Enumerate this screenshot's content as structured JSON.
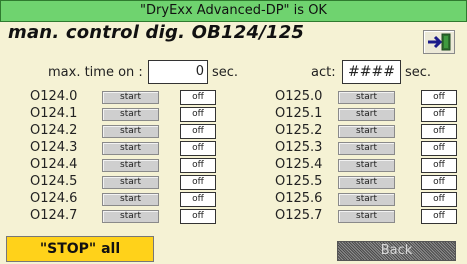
{
  "status_bar": "\"DryExx Advanced-DP\" is OK",
  "title": "man. control dig.  OB124/125",
  "max_time": {
    "label": "max. time on :",
    "value": "0",
    "unit": "sec."
  },
  "act": {
    "label": "act:",
    "value": "####",
    "unit": "sec."
  },
  "left_column": [
    {
      "label": "O124.0",
      "start": "start",
      "state": "off"
    },
    {
      "label": "O124.1",
      "start": "start",
      "state": "off"
    },
    {
      "label": "O124.2",
      "start": "start",
      "state": "off"
    },
    {
      "label": "O124.3",
      "start": "start",
      "state": "off"
    },
    {
      "label": "O124.4",
      "start": "start",
      "state": "off"
    },
    {
      "label": "O124.5",
      "start": "start",
      "state": "off"
    },
    {
      "label": "O124.6",
      "start": "start",
      "state": "off"
    },
    {
      "label": "O124.7",
      "start": "start",
      "state": "off"
    }
  ],
  "right_column": [
    {
      "label": "O125.0",
      "start": "start",
      "state": "off"
    },
    {
      "label": "O125.1",
      "start": "start",
      "state": "off"
    },
    {
      "label": "O125.2",
      "start": "start",
      "state": "off"
    },
    {
      "label": "O125.3",
      "start": "start",
      "state": "off"
    },
    {
      "label": "O125.4",
      "start": "start",
      "state": "off"
    },
    {
      "label": "O125.5",
      "start": "start",
      "state": "off"
    },
    {
      "label": "O125.6",
      "start": "start",
      "state": "off"
    },
    {
      "label": "O125.7",
      "start": "start",
      "state": "off"
    }
  ],
  "buttons": {
    "stop_all": "\"STOP\" all",
    "back": "Back"
  },
  "icons": {
    "exit": "exit-door-icon"
  },
  "colors": {
    "status_ok": "#6fd36f",
    "stop": "#ffd21a",
    "background": "#f5f2d4"
  }
}
